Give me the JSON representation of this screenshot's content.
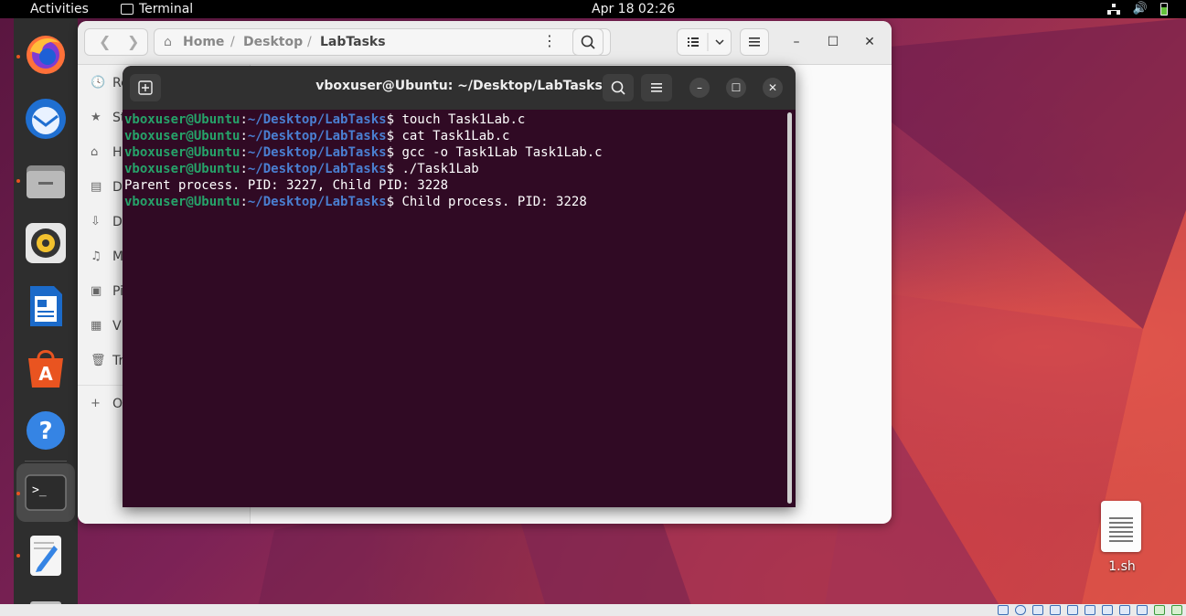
{
  "topbar": {
    "activities": "Activities",
    "app_name": "Terminal",
    "clock": "Apr 18  02:26",
    "icons": [
      "network-icon",
      "volume-icon",
      "battery-icon"
    ]
  },
  "dock": {
    "apps": [
      "firefox",
      "thunderbird",
      "files",
      "rhythmbox",
      "libreoffice-writer",
      "app-center",
      "help",
      "terminal",
      "text-editor",
      "more"
    ],
    "terminal_label": ">_"
  },
  "files": {
    "path": {
      "home": "Home",
      "desktop": "Desktop",
      "current": "LabTasks"
    },
    "sidebar": [
      {
        "icon": "clock-icon",
        "label": "Re"
      },
      {
        "icon": "star-icon",
        "label": "St"
      },
      {
        "icon": "home-icon",
        "label": "H"
      },
      {
        "icon": "document-icon",
        "label": "D"
      },
      {
        "icon": "download-icon",
        "label": "D"
      },
      {
        "icon": "music-icon",
        "label": "M"
      },
      {
        "icon": "picture-icon",
        "label": "Pi"
      },
      {
        "icon": "video-icon",
        "label": "V"
      },
      {
        "icon": "trash-icon",
        "label": "Tr"
      },
      {
        "icon": "plus-icon",
        "label": "O"
      }
    ]
  },
  "terminal": {
    "title": "vboxuser@Ubuntu: ~/Desktop/LabTasks",
    "user_host": "vboxuser@Ubuntu",
    "cwd": "~/Desktop/LabTasks",
    "lines": [
      {
        "type": "cmd",
        "command": "touch Task1Lab.c"
      },
      {
        "type": "cmd",
        "command": "cat Task1Lab.c"
      },
      {
        "type": "cmd",
        "command": "gcc -o Task1Lab Task1Lab.c"
      },
      {
        "type": "cmd",
        "command": "./Task1Lab"
      },
      {
        "type": "out",
        "text": "Parent process. PID: 3227, Child PID: 3228"
      },
      {
        "type": "cmd",
        "command": "Child process. PID: 3228"
      }
    ]
  },
  "desktop": {
    "file_label": "1.sh"
  },
  "colors": {
    "terminal_bg": "#300a24",
    "prompt_user": "#26a269",
    "prompt_path": "#12488b",
    "accent": "#e95420"
  }
}
